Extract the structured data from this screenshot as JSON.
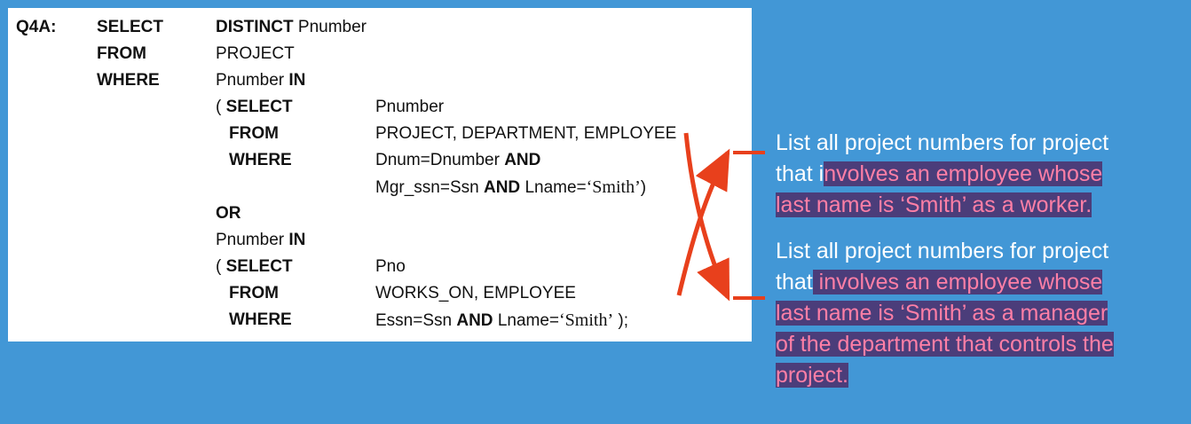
{
  "query": {
    "label": "Q4A:",
    "select_kw": "SELECT",
    "distinct_kw": "DISTINCT",
    "pnumber": "Pnumber",
    "from_kw": "FROM",
    "project": "PROJECT",
    "where_kw": "WHERE",
    "pnumber_in": "Pnumber",
    "in_kw": "IN",
    "sub1": {
      "open": "(",
      "select_kw": "SELECT",
      "select_val": "Pnumber",
      "from_kw": "FROM",
      "from_val": "PROJECT, DEPARTMENT, EMPLOYEE",
      "where_kw": "WHERE",
      "where_a": "Dnum=Dnumber",
      "and_kw": "AND",
      "line2_a": "Mgr_ssn=Ssn",
      "line2_and": "AND",
      "line2_b": "Lname=",
      "smith": "‘Smith’",
      "close": ")"
    },
    "or_kw": "OR",
    "pnumber_in2": "Pnumber",
    "in_kw2": "IN",
    "sub2": {
      "open": "(",
      "select_kw": "SELECT",
      "select_val": "Pno",
      "from_kw": "FROM",
      "from_val": "WORKS_ON, EMPLOYEE",
      "where_kw": "WHERE",
      "where_a": "Essn=Ssn",
      "and_kw": "AND",
      "where_b": "Lname=",
      "smith": "‘Smith’",
      "close": " );"
    }
  },
  "annotation_top": {
    "line1": "List all project numbers for project",
    "line2_plain": "that i",
    "line2_hl": "nvolves an employee whose",
    "line3_hl": "last name is ‘Smith’ as a worker."
  },
  "annotation_bottom": {
    "line1": "List all project numbers for project",
    "line2_plain": "that",
    "line2_hl": " involves an employee whose",
    "line3_hl": "last name is ‘Smith’ as a manager",
    "line4_hl": "of the department that controls the",
    "line5_hl": "project."
  },
  "colors": {
    "background": "#4297d6",
    "arrow": "#e8401c",
    "highlight_bg": "#4b3d7a",
    "highlight_text": "#ff7fa6"
  }
}
